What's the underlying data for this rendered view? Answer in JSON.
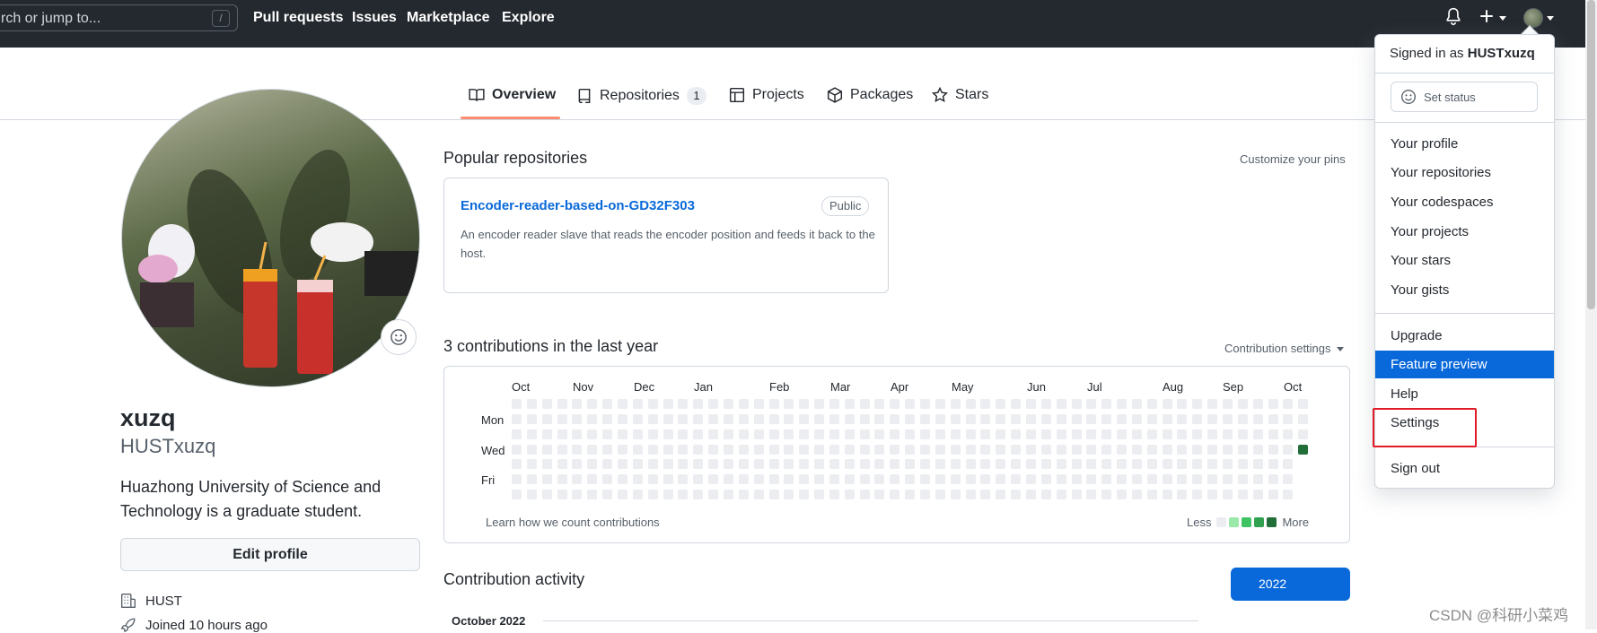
{
  "header": {
    "search_placeholder": "rch or jump to...",
    "search_key": "/",
    "nav": [
      "Pull requests",
      "Issues",
      "Marketplace",
      "Explore"
    ]
  },
  "tabs": [
    {
      "label": "Overview",
      "icon": "book-icon"
    },
    {
      "label": "Repositories",
      "icon": "repo-icon",
      "count": "1"
    },
    {
      "label": "Projects",
      "icon": "table-icon"
    },
    {
      "label": "Packages",
      "icon": "package-icon"
    },
    {
      "label": "Stars",
      "icon": "star-icon"
    }
  ],
  "profile": {
    "name": "xuzq",
    "login": "HUSTxuzq",
    "bio": "Huazhong University of Science and Technology is a graduate student.",
    "edit_label": "Edit profile",
    "org": "HUST",
    "joined": "Joined 10 hours ago"
  },
  "popular": {
    "title": "Popular repositories",
    "customize": "Customize your pins",
    "repo": {
      "name": "Encoder-reader-based-on-GD32F303",
      "visibility": "Public",
      "description": "An encoder reader slave that reads the encoder position and feeds it back to the host."
    }
  },
  "contributions": {
    "title": "3 contributions in the last year",
    "settings": "Contribution settings",
    "months": [
      "Oct",
      "Nov",
      "Dec",
      "Jan",
      "Feb",
      "Mar",
      "Apr",
      "May",
      "Jun",
      "Jul",
      "Aug",
      "Sep",
      "Oct"
    ],
    "day_labels": [
      "Mon",
      "Wed",
      "Fri"
    ],
    "learn": "Learn how we count contributions",
    "less": "Less",
    "more": "More",
    "colors": [
      "#ebedf0",
      "#9be9a8",
      "#40c463",
      "#30a14e",
      "#216e39"
    ]
  },
  "activity": {
    "title": "Contribution activity",
    "year": "2022",
    "month": "October 2022"
  },
  "dropdown": {
    "signed_prefix": "Signed in as",
    "username": "HUSTxuzq",
    "set_status": "Set status",
    "group1": [
      "Your profile",
      "Your repositories",
      "Your codespaces",
      "Your projects",
      "Your stars",
      "Your gists"
    ],
    "group2": [
      "Upgrade",
      "Feature preview",
      "Help",
      "Settings"
    ],
    "sign_out": "Sign out",
    "active_item": "Feature preview"
  },
  "watermark": "CSDN @科研小菜鸡"
}
